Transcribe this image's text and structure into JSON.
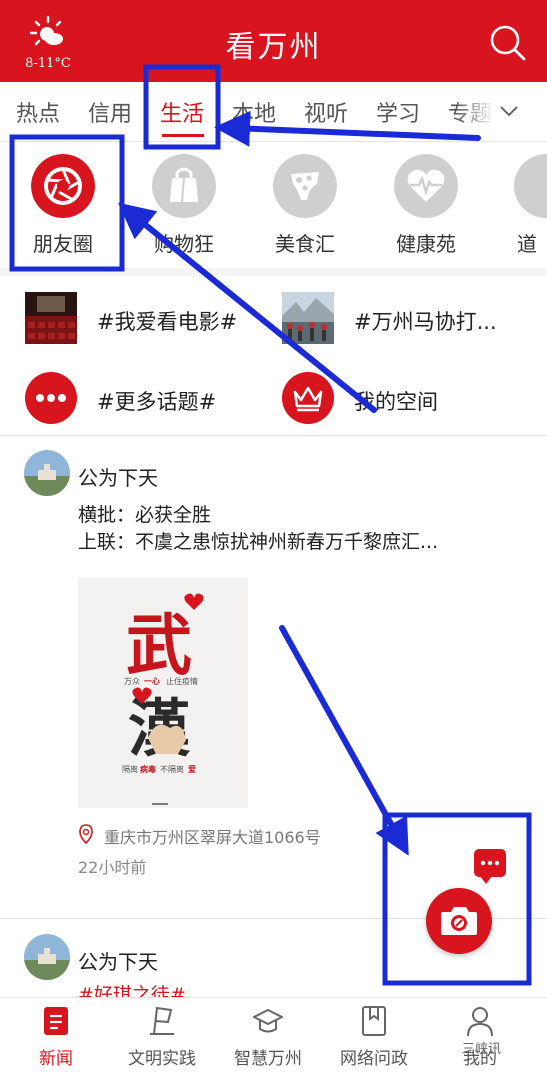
{
  "header": {
    "temperature": "8-11°C",
    "title": "看万州",
    "weather_icon": "sun-cloud-icon",
    "search_icon": "search-icon",
    "bg_color": "#d8141e"
  },
  "tabs": {
    "items": [
      "热点",
      "信用",
      "生活",
      "本地",
      "视听",
      "学习",
      "专题"
    ],
    "active": "生活",
    "more_icon": "chevron-down-icon"
  },
  "categories": [
    {
      "label": "朋友圈",
      "icon": "camera-aperture-icon",
      "active": true
    },
    {
      "label": "购物狂",
      "icon": "shopping-bag-icon",
      "active": false
    },
    {
      "label": "美食汇",
      "icon": "food-icon",
      "active": false
    },
    {
      "label": "健康苑",
      "icon": "heart-pulse-icon",
      "active": false
    },
    {
      "label": "道",
      "icon": "more-category-icon",
      "active": false
    }
  ],
  "topics": [
    {
      "label": "#我爱看电影#",
      "thumb": "cinema-photo"
    },
    {
      "label": "#万州马协打...",
      "thumb": "runners-photo"
    },
    {
      "label": "#更多话题#",
      "thumb": "more-dots-icon"
    },
    {
      "label": "我的空间",
      "thumb": "crown-icon"
    }
  ],
  "posts": [
    {
      "author": "公为下天",
      "line1": "横批：必获全胜",
      "line2": "上联：不虞之患惊扰神州新春万千黎庶汇...",
      "image_text": {
        "char1": "武",
        "slogan1_a": "万众",
        "slogan1_b": "一心",
        "slogan1_c": "止住疫情",
        "char2": "漢",
        "slogan2_a": "隔离",
        "slogan2_b": "病毒",
        "slogan2_c": "不隔离",
        "slogan2_d": "爱"
      },
      "location": "重庆市万州区翠屏大道1066号",
      "time": "22小时前"
    },
    {
      "author": "公为下天",
      "line1": "#好琪之徒#"
    }
  ],
  "bottom_nav": [
    {
      "label": "新闻",
      "icon": "news-icon",
      "active": true
    },
    {
      "label": "文明实践",
      "icon": "flag-icon",
      "active": false
    },
    {
      "label": "智慧万州",
      "icon": "graduation-cap-icon",
      "active": false
    },
    {
      "label": "网络问政",
      "icon": "bookmark-icon",
      "active": false
    },
    {
      "label": "我的",
      "icon": "user-icon",
      "active": false
    }
  ],
  "watermark": "三峡讯"
}
